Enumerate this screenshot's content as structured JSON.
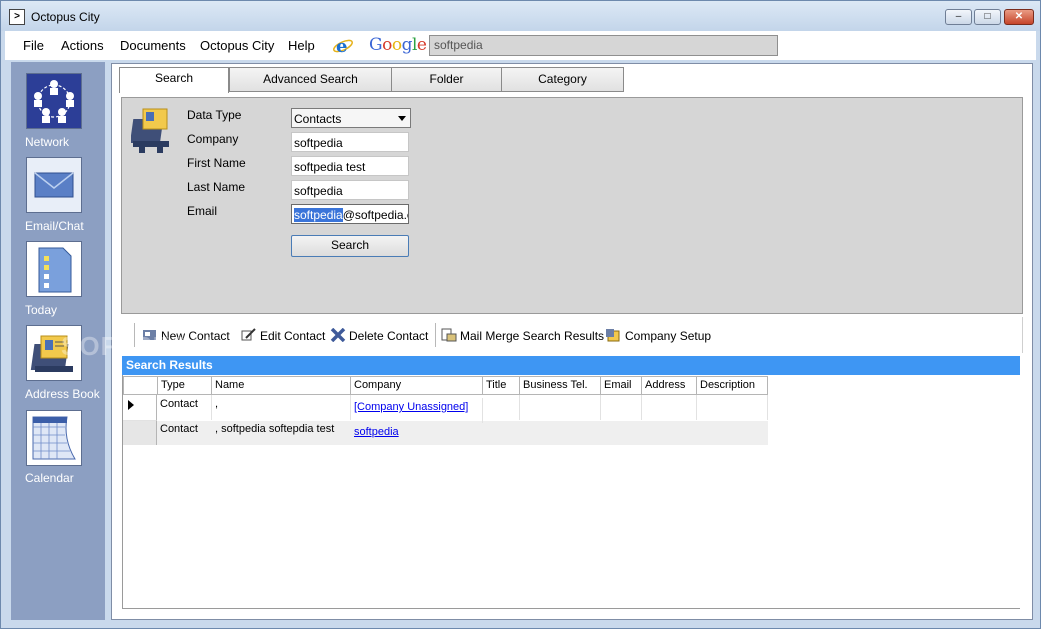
{
  "window": {
    "title": "Octopus City",
    "controls": [
      "minimize",
      "maximize",
      "close"
    ]
  },
  "menu": {
    "items": [
      "File",
      "Actions",
      "Documents",
      "Octopus City",
      "Help"
    ],
    "google_label": "Google",
    "search_value": "softpedia"
  },
  "sidebar": {
    "items": [
      {
        "label": "Network",
        "icon": "network-icon"
      },
      {
        "label": "Email/Chat",
        "icon": "envelope-icon"
      },
      {
        "label": "Today",
        "icon": "checklist-icon"
      },
      {
        "label": "Address Book",
        "icon": "address-book-icon"
      },
      {
        "label": "Calendar",
        "icon": "calendar-icon"
      }
    ]
  },
  "tabs": [
    {
      "label": "Search",
      "active": true
    },
    {
      "label": "Advanced Search",
      "active": false
    },
    {
      "label": "Folder",
      "active": false
    },
    {
      "label": "Category",
      "active": false
    }
  ],
  "form": {
    "data_type_label": "Data Type",
    "data_type_value": "Contacts",
    "company_label": "Company",
    "company_value": "softpedia",
    "first_name_label": "First Name",
    "first_name_value": "softpedia test",
    "last_name_label": "Last Name",
    "last_name_value": "softpedia",
    "email_label": "Email",
    "email_value_selected": "softpedia",
    "email_value_rest": "@softpedia.co",
    "search_button": "Search"
  },
  "toolbar": {
    "new_contact": "New Contact",
    "edit_contact": "Edit Contact",
    "delete_contact": "Delete Contact",
    "mail_merge": "Mail Merge Search Results",
    "company_setup": "Company Setup"
  },
  "results": {
    "header": "Search Results",
    "columns": [
      "Type",
      "Name",
      "Company",
      "Title",
      "Business Tel.",
      "Email",
      "Address",
      "Description"
    ],
    "rows": [
      {
        "type": "Contact",
        "name": ",",
        "company": "[Company Unassigned]",
        "title": "",
        "business_tel": "",
        "email": "",
        "address": "",
        "description": ""
      },
      {
        "type": "Contact",
        "name": ", softpedia softepdia test",
        "company": "softpedia",
        "title": "",
        "business_tel": "",
        "email": "",
        "address": "",
        "description": ""
      }
    ]
  },
  "watermark": "SOFTPEDIA",
  "colors": {
    "sidebar": "#8c9fc2",
    "results_header": "#3e96f3",
    "link": "#0000ee",
    "selection": "#3a74d9"
  }
}
